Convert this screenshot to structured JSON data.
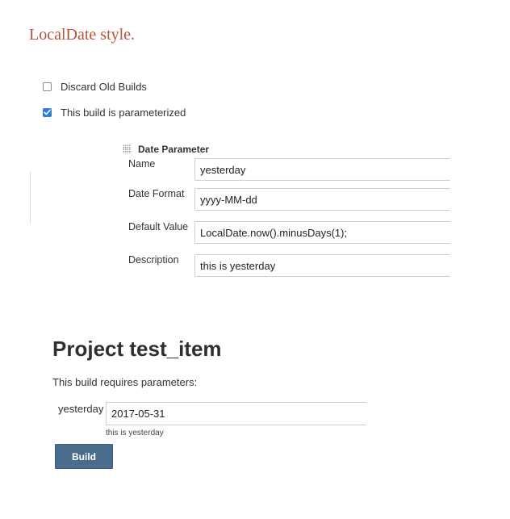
{
  "heading": "LocalDate style.",
  "options": {
    "discard_old_builds": {
      "label": "Discard Old Builds",
      "checked": false
    },
    "parameterized": {
      "label": "This build is parameterized",
      "checked": true
    }
  },
  "date_parameter": {
    "title": "Date Parameter",
    "name_label": "Name",
    "name_value": "yesterday",
    "format_label": "Date Format",
    "format_value": "yyyy-MM-dd",
    "default_label": "Default Value",
    "default_value": "LocalDate.now().minusDays(1);",
    "description_label": "Description",
    "description_value": "this is yesterday"
  },
  "build_page": {
    "project_title": "Project test_item",
    "requires_text": "This build requires parameters:",
    "param_label": "yesterday",
    "param_value": "2017-05-31",
    "param_description": "this is yesterday",
    "build_button_label": "Build"
  },
  "colors": {
    "heading": "#b5533c",
    "checkbox_checked": "#2d7cd6",
    "build_button": "#4b6d8d"
  },
  "icons": {
    "drag_handle": "grip-icon",
    "checkmark": "check-icon"
  }
}
